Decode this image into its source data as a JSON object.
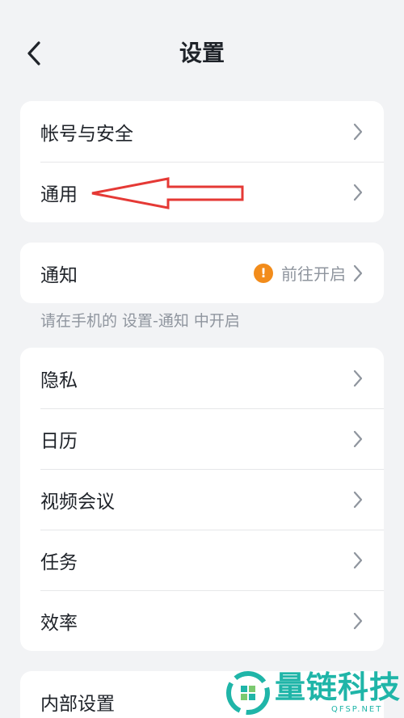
{
  "header": {
    "title": "设置"
  },
  "sections": {
    "account": {
      "label": "帐号与安全"
    },
    "general": {
      "label": "通用"
    },
    "notify": {
      "label": "通知",
      "value": "前往开启",
      "warn_symbol": "!"
    },
    "notify_hint": "请在手机的 设置-通知 中开启",
    "privacy": {
      "label": "隐私"
    },
    "calendar": {
      "label": "日历"
    },
    "video": {
      "label": "视频会议"
    },
    "tasks": {
      "label": "任务"
    },
    "efficiency": {
      "label": "效率"
    },
    "internal": {
      "label": "内部设置"
    }
  },
  "watermark": {
    "text": "量链科技",
    "sub": "QFSP.NET"
  },
  "colors": {
    "background": "#f2f3f5",
    "warning": "#f28c1b",
    "annotation_arrow": "#e53935",
    "watermark": "#1fb5a8"
  }
}
